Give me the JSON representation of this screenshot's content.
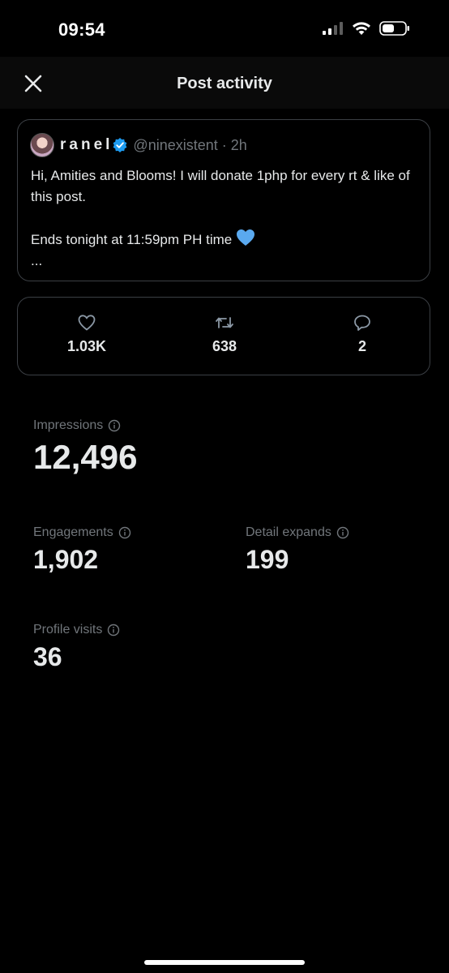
{
  "status_bar": {
    "time": "09:54",
    "icons": [
      "cellular-signal-icon",
      "wifi-icon",
      "battery-icon"
    ]
  },
  "header": {
    "title": "Post activity",
    "close_icon": "close-icon"
  },
  "post": {
    "author_name": "ranel",
    "handle_time": "@ninexistent · 2h",
    "text_line1": "Hi, Amities and Blooms! I will donate 1php for every rt & like of this post.",
    "text_line2": "Ends tonight at 11:59pm PH time",
    "text_line3": "...",
    "emoji": "blue-heart-emoji"
  },
  "metrics": {
    "likes": "1.03K",
    "reposts": "638",
    "replies": "2"
  },
  "stats": {
    "impressions_label": "Impressions",
    "impressions_value": "12,496",
    "engagements_label": "Engagements",
    "engagements_value": "1,902",
    "detail_expands_label": "Detail expands",
    "detail_expands_value": "199",
    "profile_visits_label": "Profile visits",
    "profile_visits_value": "36"
  },
  "colors": {
    "background": "#000000",
    "text_primary": "#e7e9ea",
    "text_secondary": "#71767b",
    "border": "#3b3f44",
    "verified_blue": "#1d9bf0"
  }
}
